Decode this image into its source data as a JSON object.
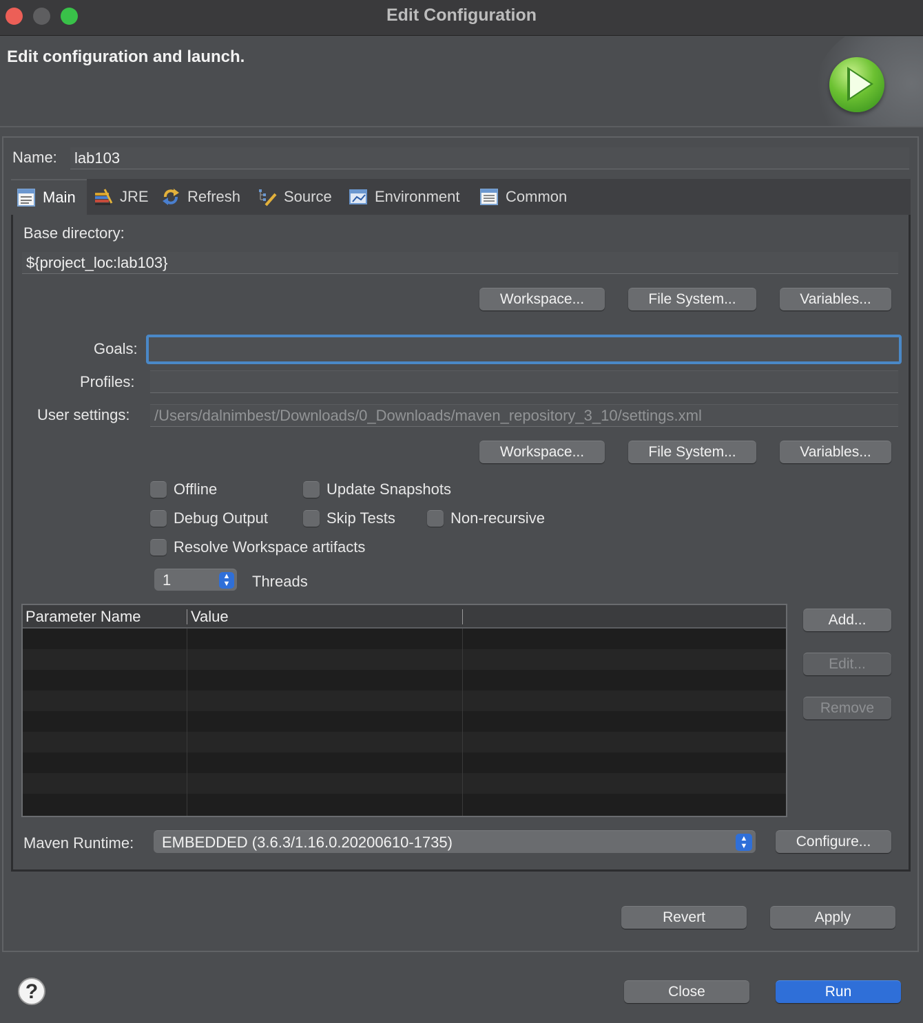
{
  "window": {
    "title": "Edit Configuration"
  },
  "banner": {
    "text": "Edit configuration and launch.",
    "icon": "run-icon"
  },
  "name": {
    "label": "Name:",
    "value": "lab103"
  },
  "tabs": [
    {
      "label": "Main",
      "icon": "main-tab-icon",
      "active": true
    },
    {
      "label": "JRE",
      "icon": "jre-icon"
    },
    {
      "label": "Refresh",
      "icon": "refresh-icon"
    },
    {
      "label": "Source",
      "icon": "source-icon"
    },
    {
      "label": "Environment",
      "icon": "environment-icon"
    },
    {
      "label": "Common",
      "icon": "common-icon"
    }
  ],
  "main": {
    "base_directory": {
      "label": "Base directory:",
      "value": "${project_loc:lab103}",
      "buttons": [
        "Workspace...",
        "File System...",
        "Variables..."
      ]
    },
    "goals": {
      "label": "Goals:",
      "value": ""
    },
    "profiles": {
      "label": "Profiles:",
      "value": ""
    },
    "user_settings": {
      "label": "User settings:",
      "value": "/Users/dalnimbest/Downloads/0_Downloads/maven_repository_3_10/settings.xml",
      "buttons": [
        "Workspace...",
        "File System...",
        "Variables..."
      ]
    },
    "checkboxes": {
      "offline": "Offline",
      "update_snapshots": "Update Snapshots",
      "debug_output": "Debug Output",
      "skip_tests": "Skip Tests",
      "non_recursive": "Non-recursive",
      "resolve_workspace": "Resolve Workspace artifacts"
    },
    "threads": {
      "value": "1",
      "label": "Threads"
    },
    "parameters": {
      "columns": [
        "Parameter Name",
        "Value",
        ""
      ],
      "rows": [],
      "buttons": {
        "add": "Add...",
        "edit": "Edit...",
        "remove": "Remove"
      }
    },
    "maven_runtime": {
      "label": "Maven Runtime:",
      "value": "EMBEDDED (3.6.3/1.16.0.20200610-1735)",
      "configure": "Configure..."
    }
  },
  "actions": {
    "revert": "Revert",
    "apply": "Apply"
  },
  "footer": {
    "help": "?",
    "close": "Close",
    "run": "Run"
  },
  "colors": {
    "accent": "#2f6fd8",
    "focus": "#4a88c7",
    "background": "#4b4d50"
  }
}
